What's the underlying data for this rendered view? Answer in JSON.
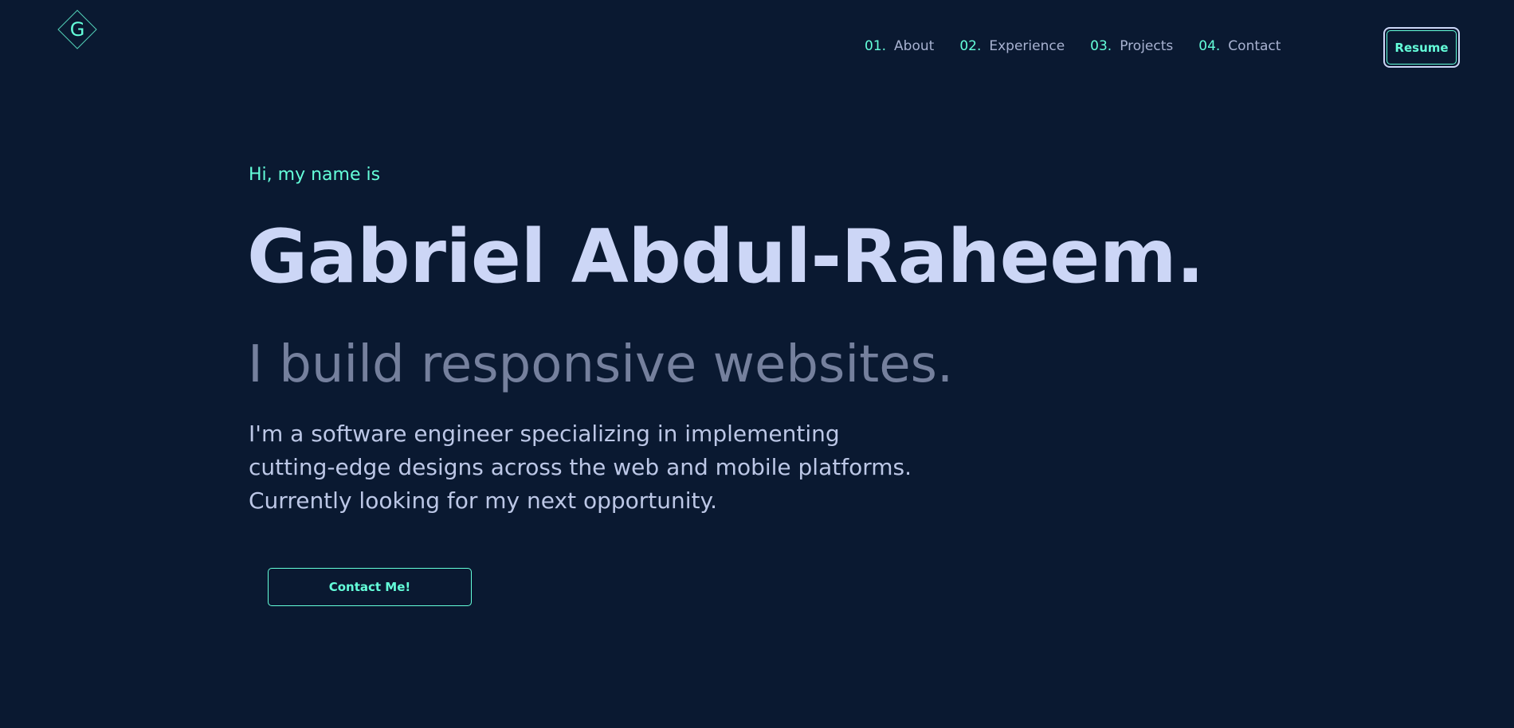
{
  "logo": {
    "letter": "G",
    "icon": "diamond-logo-icon"
  },
  "nav": {
    "items": [
      {
        "number": "01.",
        "label": "About"
      },
      {
        "number": "02.",
        "label": "Experience"
      },
      {
        "number": "03.",
        "label": "Projects"
      },
      {
        "number": "04.",
        "label": "Contact"
      }
    ],
    "resume_label": "Resume"
  },
  "hero": {
    "greeting": "Hi, my name is",
    "name": "Gabriel Abdul-Raheem.",
    "tagline": "I build responsive websites.",
    "bio_lines": [
      "I'm a software engineer specializing in implementing",
      "cutting-edge designs across the web and mobile platforms.",
      "Currently looking for my next opportunity."
    ],
    "contact_label": "Contact Me!"
  },
  "colors": {
    "background": "#0a1931",
    "accent": "#64ffda",
    "heading": "#ccd6f6",
    "muted": "#8892b0"
  }
}
